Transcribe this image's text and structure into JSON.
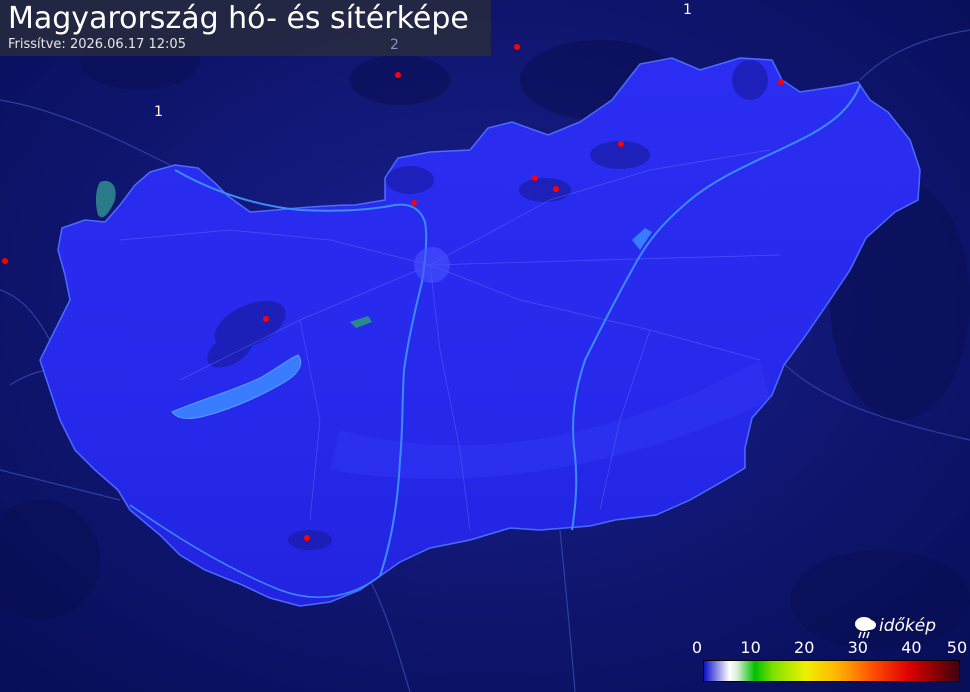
{
  "title": "Magyarország hó- és sítérképe",
  "updated": "Frissítve: 2026.06.17 12:05",
  "map_labels": [
    "1",
    "2",
    "1"
  ],
  "logo": {
    "text": "időkép",
    "icon": "cloud-icon"
  },
  "legend": {
    "ticks": [
      "0",
      "10",
      "20",
      "30",
      "40",
      "50"
    ],
    "colors": [
      "#0a10c8",
      "#ffffff",
      "#00c000",
      "#f0f000",
      "#ff5000",
      "#e00000",
      "#400010"
    ]
  },
  "colors": {
    "background": "#0a1266",
    "country_fill": "#2a2cf0",
    "lake": "#3a7cff",
    "station": "#ff0000"
  }
}
